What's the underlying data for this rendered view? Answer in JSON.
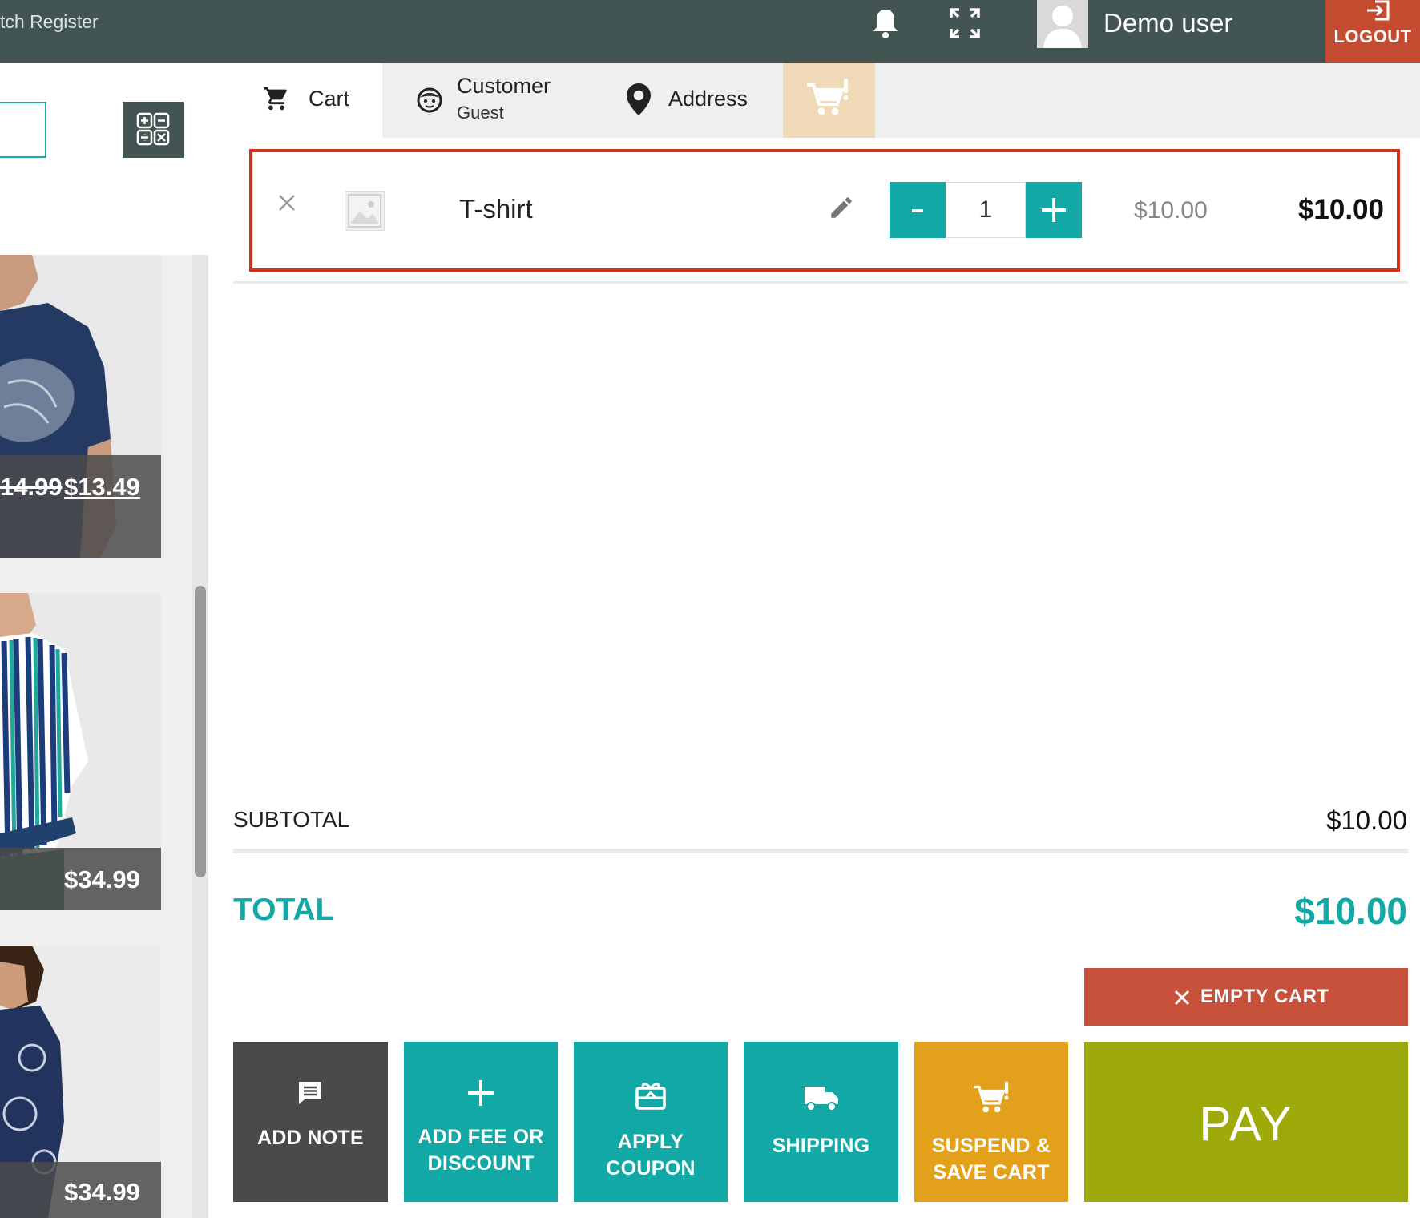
{
  "topbar": {
    "register_title": "tch Register",
    "user_name": "Demo user",
    "logout_label": "LOGOUT"
  },
  "products": [
    {
      "old_price": "14.99",
      "price": "$13.49"
    },
    {
      "old_price": "",
      "price": "$34.99"
    },
    {
      "old_price": "",
      "price": "$34.99"
    }
  ],
  "tabs": {
    "cart": "Cart",
    "customer": "Customer",
    "customer_value": "Guest",
    "address": "Address"
  },
  "cart": {
    "items": [
      {
        "name": "T-shirt",
        "quantity": "1",
        "unit_price": "$10.00",
        "line_total": "$10.00"
      }
    ],
    "subtotal_label": "SUBTOTAL",
    "subtotal": "$10.00",
    "total_label": "TOTAL",
    "total": "$10.00"
  },
  "actions": {
    "empty_cart": "EMPTY CART",
    "add_note": "ADD NOTE",
    "add_fee_line1": "ADD FEE OR",
    "add_fee_line2": "DISCOUNT",
    "apply_coupon_line1": "APPLY",
    "apply_coupon_line2": "COUPON",
    "shipping": "SHIPPING",
    "suspend_line1": "SUSPEND &",
    "suspend_line2": "SAVE CART",
    "pay": "PAY"
  },
  "colors": {
    "topbar": "#435553",
    "accent": "#12a8a6",
    "logout": "#c44b2f",
    "empty_cart": "#c8513b",
    "suspend": "#e3a11b",
    "pay": "#9eaa0a",
    "note": "#4a4a4a",
    "highlight_border": "#d6301f"
  }
}
